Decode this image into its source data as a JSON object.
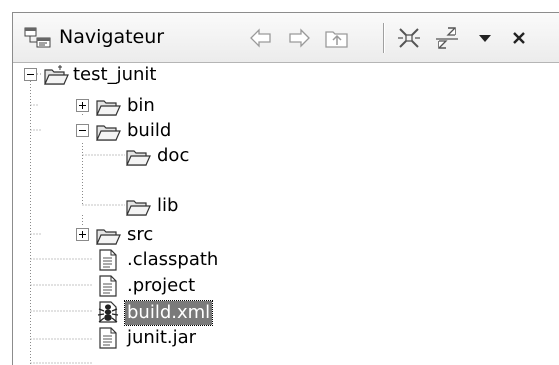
{
  "view": {
    "title": "Navigateur",
    "toolbar": [
      {
        "name": "back-arrow-icon"
      },
      {
        "name": "forward-arrow-icon"
      },
      {
        "name": "up-folder-icon"
      },
      {
        "name": "collapse-all-icon"
      },
      {
        "name": "link-with-editor-icon"
      },
      {
        "name": "view-menu-dropdown-icon"
      },
      {
        "name": "close-icon"
      }
    ]
  },
  "tree": {
    "root": {
      "label": "test_junit",
      "expanded": true
    },
    "items": [
      {
        "label": "bin",
        "type": "folder",
        "expanded": false
      },
      {
        "label": "build",
        "type": "folder",
        "expanded": true
      },
      {
        "label": "doc",
        "type": "folder"
      },
      {
        "label": "lib",
        "type": "folder"
      },
      {
        "label": "src",
        "type": "folder",
        "expanded": false
      },
      {
        "label": ".classpath",
        "type": "file"
      },
      {
        "label": ".project",
        "type": "file"
      },
      {
        "label": "build.xml",
        "type": "ant-file",
        "selected": true
      },
      {
        "label": "junit.jar",
        "type": "file"
      }
    ]
  }
}
